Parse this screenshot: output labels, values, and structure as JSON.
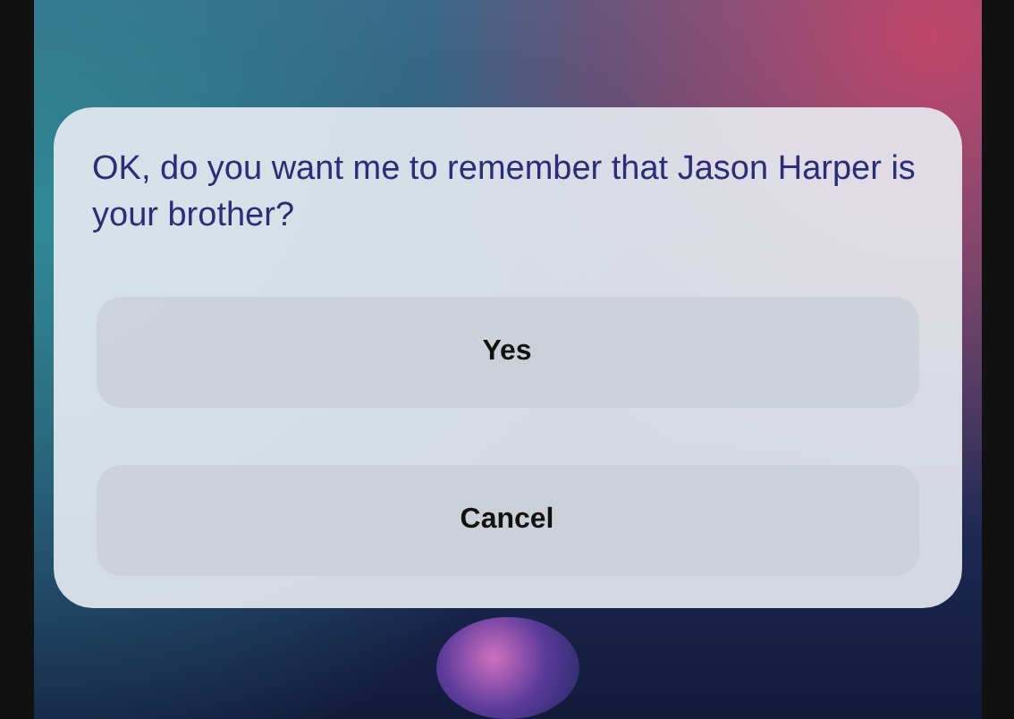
{
  "dialog": {
    "message": "OK, do you want me to remember that Jason Harper is your brother?",
    "buttons": [
      {
        "label": "Yes"
      },
      {
        "label": "Cancel"
      }
    ]
  }
}
